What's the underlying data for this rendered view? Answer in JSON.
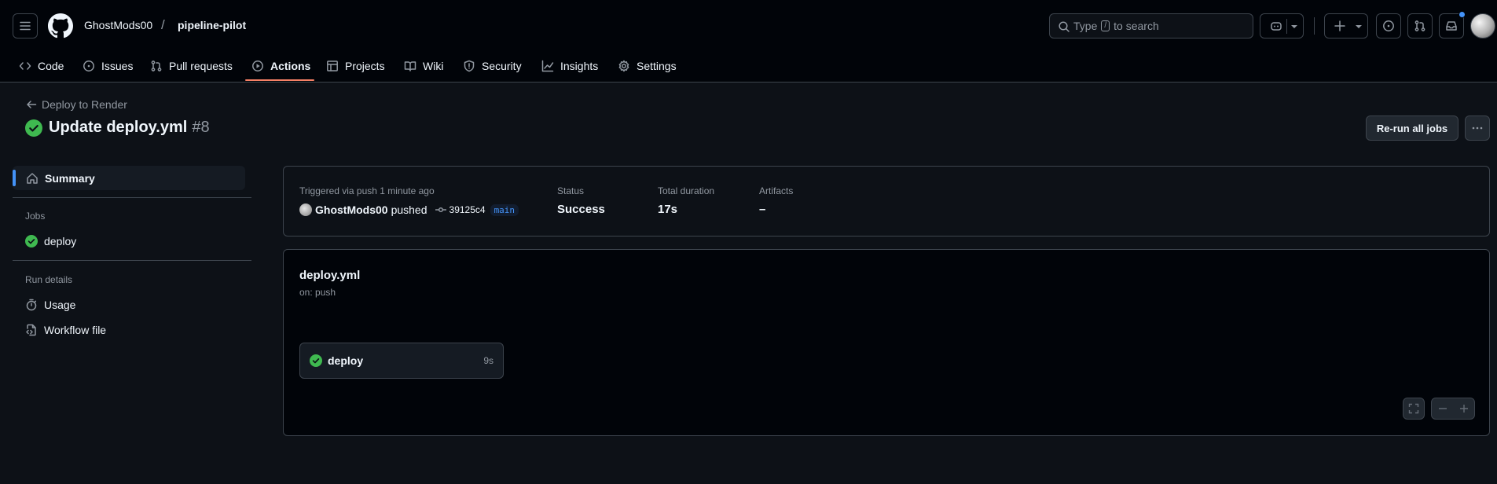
{
  "header": {
    "owner": "GhostMods00",
    "separator": "/",
    "repo": "pipeline-pilot",
    "search_placeholder_pre": "Type",
    "search_key": "/",
    "search_placeholder_post": "to search"
  },
  "tabs": [
    {
      "label": "Code",
      "icon": "code-icon"
    },
    {
      "label": "Issues",
      "icon": "issue-opened-icon"
    },
    {
      "label": "Pull requests",
      "icon": "git-pull-request-icon"
    },
    {
      "label": "Actions",
      "icon": "play-icon",
      "active": true
    },
    {
      "label": "Projects",
      "icon": "table-icon"
    },
    {
      "label": "Wiki",
      "icon": "book-icon"
    },
    {
      "label": "Security",
      "icon": "shield-icon"
    },
    {
      "label": "Insights",
      "icon": "graph-icon"
    },
    {
      "label": "Settings",
      "icon": "gear-icon"
    }
  ],
  "run": {
    "back_label": "Deploy to Render",
    "title": "Update deploy.yml",
    "number": "#8",
    "rerun_label": "Re-run all jobs"
  },
  "sidebar": {
    "summary_label": "Summary",
    "jobs_heading": "Jobs",
    "job_label": "deploy",
    "run_details_heading": "Run details",
    "usage_label": "Usage",
    "workflow_file_label": "Workflow file"
  },
  "summary": {
    "triggered_label": "Triggered via push 1 minute ago",
    "actor": "GhostMods00",
    "action": "pushed",
    "commit": "39125c4",
    "branch": "main",
    "status_label": "Status",
    "status_value": "Success",
    "duration_label": "Total duration",
    "duration_value": "17s",
    "artifacts_label": "Artifacts",
    "artifacts_value": "–"
  },
  "workflow": {
    "file": "deploy.yml",
    "trigger": "on: push",
    "job_name": "deploy",
    "job_time": "9s"
  },
  "colors": {
    "background": "#0d1117",
    "header_bg": "#010409",
    "success": "#3fb950",
    "accent": "#4493f8",
    "tab_underline": "#f78166"
  }
}
